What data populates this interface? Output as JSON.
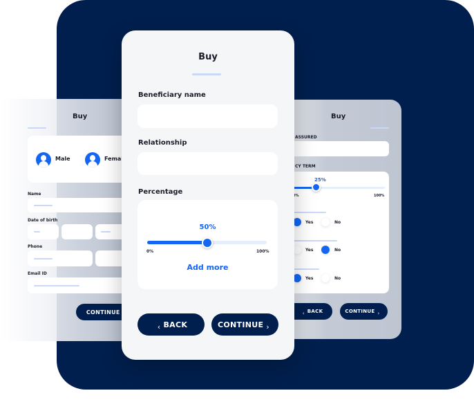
{
  "colors": {
    "navy": "#001f4e",
    "accent": "#1466f2"
  },
  "left_card": {
    "title": "Buy",
    "gender": [
      {
        "label": "Male",
        "icon": "male-avatar-icon"
      },
      {
        "label": "Female",
        "icon": "female-avatar-icon"
      }
    ],
    "fields": {
      "name": "Name",
      "dob": "Date of birth",
      "phone": "Phone",
      "email": "Email ID"
    },
    "continue": "CONTINUE",
    "chevron_right": "›"
  },
  "center_card": {
    "title": "Buy",
    "beneficiary_label": "Beneficiary name",
    "beneficiary_value": "",
    "relationship_label": "Relationship",
    "relationship_value": "",
    "percentage_label": "Percentage",
    "slider": {
      "value_label": "50%",
      "value": 50,
      "min_label": "0%",
      "max_label": "100%"
    },
    "add_more": "Add more",
    "back": "BACK",
    "continue": "CONTINUE",
    "chevron_left": "‹",
    "chevron_right": "›"
  },
  "right_card": {
    "title": "Buy",
    "sum_assured_label": "ASSURED",
    "policy_term_label": "CY TERM",
    "slider": {
      "value_label": "25%",
      "value": 25,
      "min_label": "0%",
      "max_label": "100%"
    },
    "questions": [
      {
        "yes": "Yes",
        "no": "No",
        "selected": "yes"
      },
      {
        "yes": "Yes",
        "no": "No",
        "selected": "no"
      },
      {
        "yes": "Yes",
        "no": "No",
        "selected": "yes"
      }
    ],
    "back": "BACK",
    "continue": "CONTINUE",
    "chevron_left": "‹",
    "chevron_right": "›"
  }
}
